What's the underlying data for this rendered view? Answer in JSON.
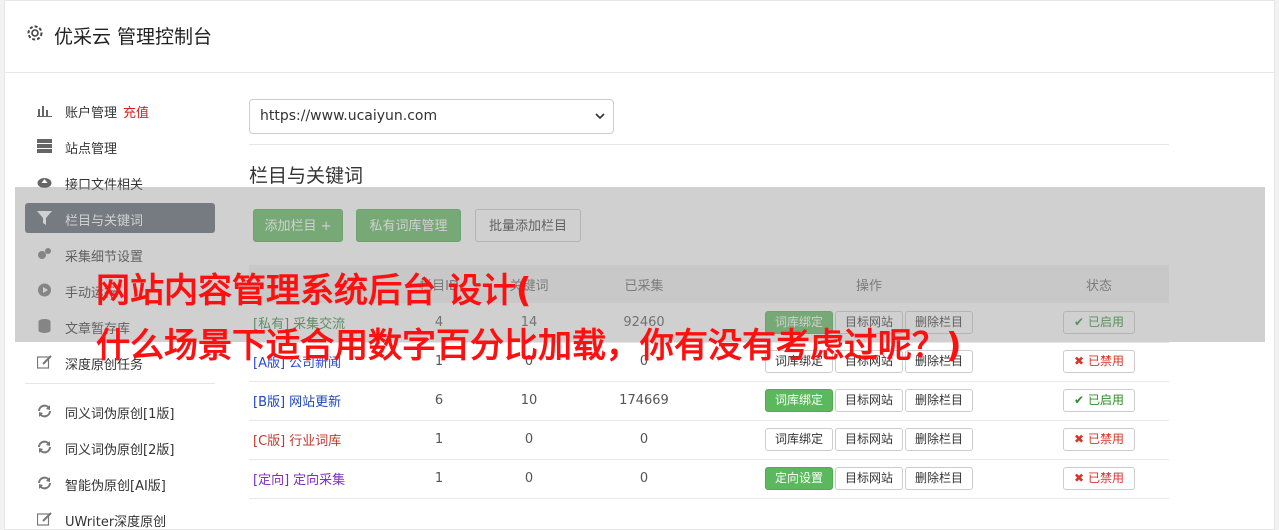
{
  "header": {
    "title": "优采云 管理控制台",
    "icon": "gear-icon"
  },
  "sidebar": {
    "items": [
      {
        "label": "账户管理",
        "extra": "充值",
        "icon": "bar-chart-icon"
      },
      {
        "label": "站点管理",
        "icon": "server-icon"
      },
      {
        "label": "接口文件相关",
        "icon": "cloud-upload-icon"
      },
      {
        "label": "栏目与关键词",
        "icon": "filter-icon",
        "active": true
      },
      {
        "label": "采集细节设置",
        "icon": "cogs-icon"
      },
      {
        "label": "手动运行",
        "icon": "play-circle-icon"
      },
      {
        "label": "文章暂存库",
        "icon": "database-icon"
      },
      {
        "label": "深度原创任务",
        "icon": "edit-icon"
      }
    ],
    "items2": [
      {
        "label": "同义词伪原创[1版]",
        "icon": "refresh-icon"
      },
      {
        "label": "同义词伪原创[2版]",
        "icon": "refresh-icon"
      },
      {
        "label": "智能伪原创[AI版]",
        "icon": "refresh-icon"
      },
      {
        "label": "UWriter深度原创",
        "icon": "edit-icon"
      }
    ]
  },
  "main": {
    "site_select": "https://www.ucaiyun.com",
    "section_title": "栏目与关键词",
    "toolbar": {
      "add_column": "添加栏目 +",
      "private_lexicon": "私有词库管理",
      "batch_add": "批量添加栏目"
    },
    "table": {
      "headers": [
        "栏目ID",
        "关键词",
        "已采集",
        "操作",
        "状态"
      ],
      "rows": [
        {
          "tag": "[私有]",
          "name": "采集交流",
          "id": "4",
          "keywords": "14",
          "collected": "92460",
          "op1": "词库绑定",
          "op1_green": true,
          "op2": "目标网站",
          "op3": "删除栏目",
          "status": "已启用",
          "status_on": true,
          "color": "c-priv"
        },
        {
          "tag": "[A版]",
          "name": "公司新闻",
          "id": "1",
          "keywords": "0",
          "collected": "0",
          "op1": "词库绑定",
          "op1_green": false,
          "op2": "目标网站",
          "op3": "删除栏目",
          "status": "已禁用",
          "status_on": false,
          "color": "c-a"
        },
        {
          "tag": "[B版]",
          "name": "网站更新",
          "id": "6",
          "keywords": "10",
          "collected": "174669",
          "op1": "词库绑定",
          "op1_green": true,
          "op2": "目标网站",
          "op3": "删除栏目",
          "status": "已启用",
          "status_on": true,
          "color": "c-b"
        },
        {
          "tag": "[C版]",
          "name": "行业词库",
          "id": "1",
          "keywords": "0",
          "collected": "0",
          "op1": "词库绑定",
          "op1_green": false,
          "op2": "目标网站",
          "op3": "删除栏目",
          "status": "已禁用",
          "status_on": false,
          "color": "c-c"
        },
        {
          "tag": "[定向]",
          "name": "定向采集",
          "id": "1",
          "keywords": "0",
          "collected": "0",
          "op1": "定向设置",
          "op1_green": true,
          "op2": "目标网站",
          "op3": "删除栏目",
          "status": "已禁用",
          "status_on": false,
          "color": "c-d"
        }
      ]
    }
  },
  "overlay": {
    "headline": "网站内容管理系统后台 设计(\n什么场景下适合用数字百分比加载，你有没有考虑过呢？)"
  },
  "colors": {
    "accent_green": "#5cb85c",
    "active_nav": "#5c6570",
    "headline_red": "#ff1010"
  }
}
